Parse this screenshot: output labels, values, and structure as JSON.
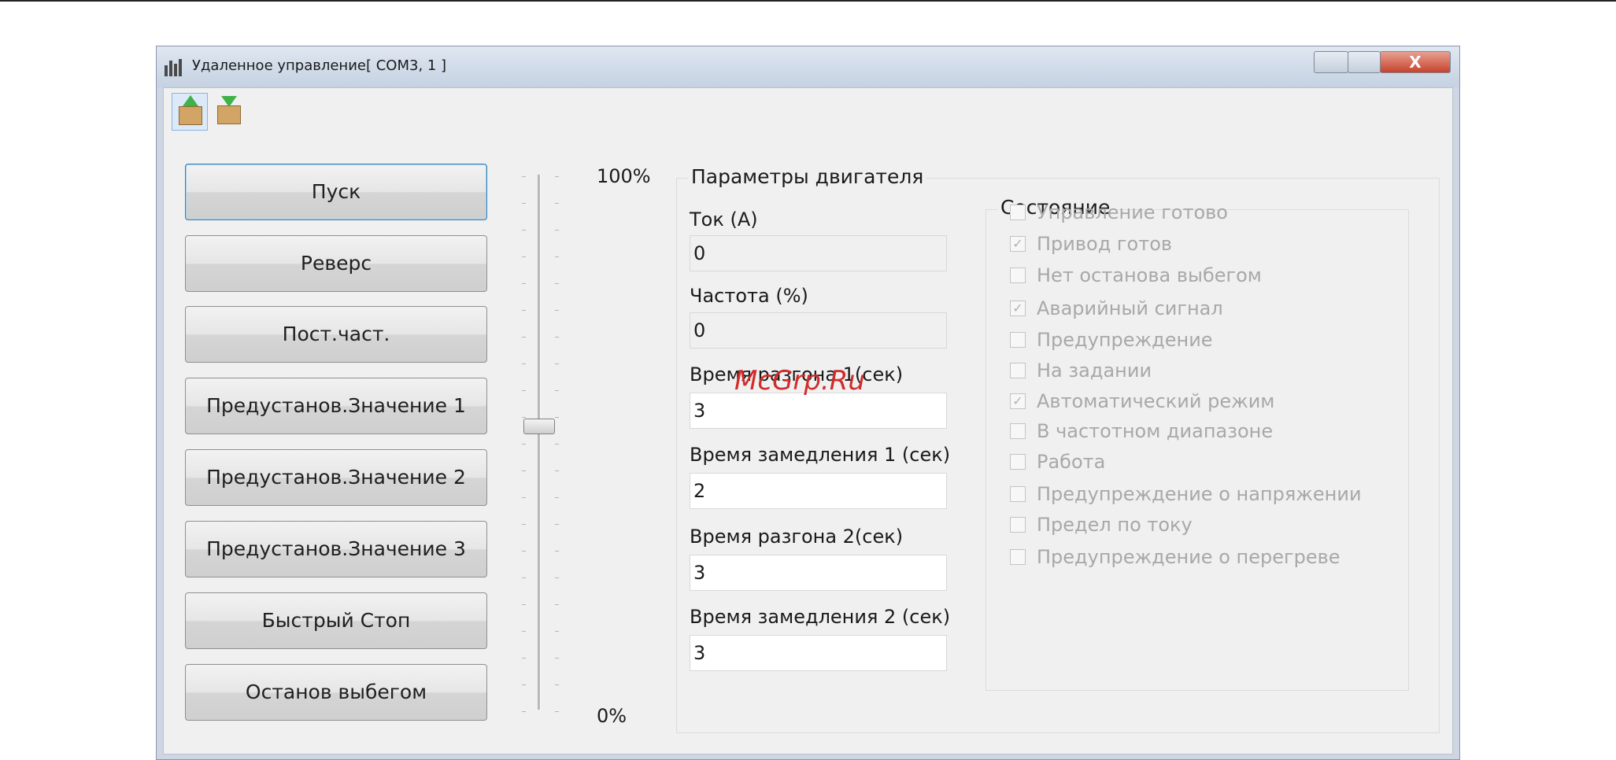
{
  "window": {
    "title": "Удаленное управление[ COM3, 1 ]",
    "close_symbol": "X"
  },
  "toolbar": {
    "icons": [
      "upload-box-icon",
      "download-box-icon"
    ]
  },
  "buttons": [
    "Пуск",
    "Реверс",
    "Пост.част.",
    "Предустанов.Значение 1",
    "Предустанов.Значение 2",
    "Предустанов.Значение 3",
    "Быстрый Стоп",
    "Останов выбегом"
  ],
  "slider": {
    "max_label": "100%",
    "min_label": "0%",
    "value_fraction": 0.53
  },
  "motor_params": {
    "title": "Параметры двигателя",
    "fields": [
      {
        "label": "Ток (А)",
        "value": "0",
        "editable": false
      },
      {
        "label": "Частота (%)",
        "value": "0",
        "editable": false
      },
      {
        "label": "Время разгона 1(сек)",
        "value": "3",
        "editable": true
      },
      {
        "label": "Время замедления 1 (сек)",
        "value": "2",
        "editable": true
      },
      {
        "label": "Время разгона 2(сек)",
        "value": "3",
        "editable": true
      },
      {
        "label": "Время замедления 2 (сек)",
        "value": "3",
        "editable": true
      }
    ]
  },
  "status": {
    "title": "Состояние",
    "items": [
      {
        "label": "Управление готово",
        "checked": false
      },
      {
        "label": "Привод готов",
        "checked": true
      },
      {
        "label": "Нет останова выбегом",
        "checked": false
      },
      {
        "label": "Аварийный сигнал",
        "checked": true
      },
      {
        "label": "Предупреждение",
        "checked": false
      },
      {
        "label": "На задании",
        "checked": false
      },
      {
        "label": "Автоматический режим",
        "checked": true
      },
      {
        "label": "В частотном диапазоне",
        "checked": false
      },
      {
        "label": "Работа",
        "checked": false
      },
      {
        "label": "Предупреждение о напряжении",
        "checked": false
      },
      {
        "label": "Предел по току",
        "checked": false
      },
      {
        "label": "Предупреждение о перегреве",
        "checked": false
      }
    ]
  },
  "watermark": "McGrp.Ru"
}
